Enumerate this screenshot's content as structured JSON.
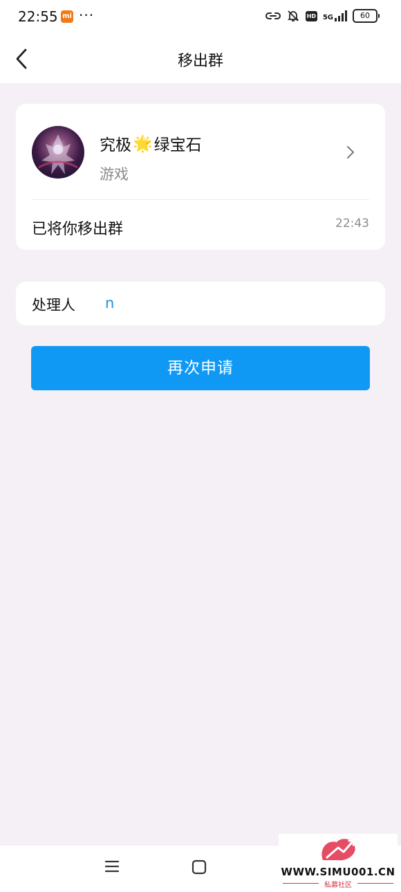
{
  "status_bar": {
    "time": "22:55",
    "mi_badge": "mi",
    "more_dots": "···",
    "network": "5G",
    "hd_badge": "HD",
    "battery": "60"
  },
  "header": {
    "title": "移出群"
  },
  "group": {
    "name": "究极",
    "name_emoji": "🌟",
    "name_suffix": "绿宝石",
    "category": "游戏",
    "notice": "已将你移出群",
    "time": "22:43"
  },
  "handler": {
    "label": "处理人",
    "value": "n"
  },
  "actions": {
    "reapply_label": "再次申请"
  },
  "watermark": {
    "url": "WWW.SIMU001.CN",
    "subtitle": "私募社区"
  },
  "colors": {
    "accent": "#0f99f5",
    "page_bg": "#f5f0f5",
    "link": "#1a8fe0"
  }
}
